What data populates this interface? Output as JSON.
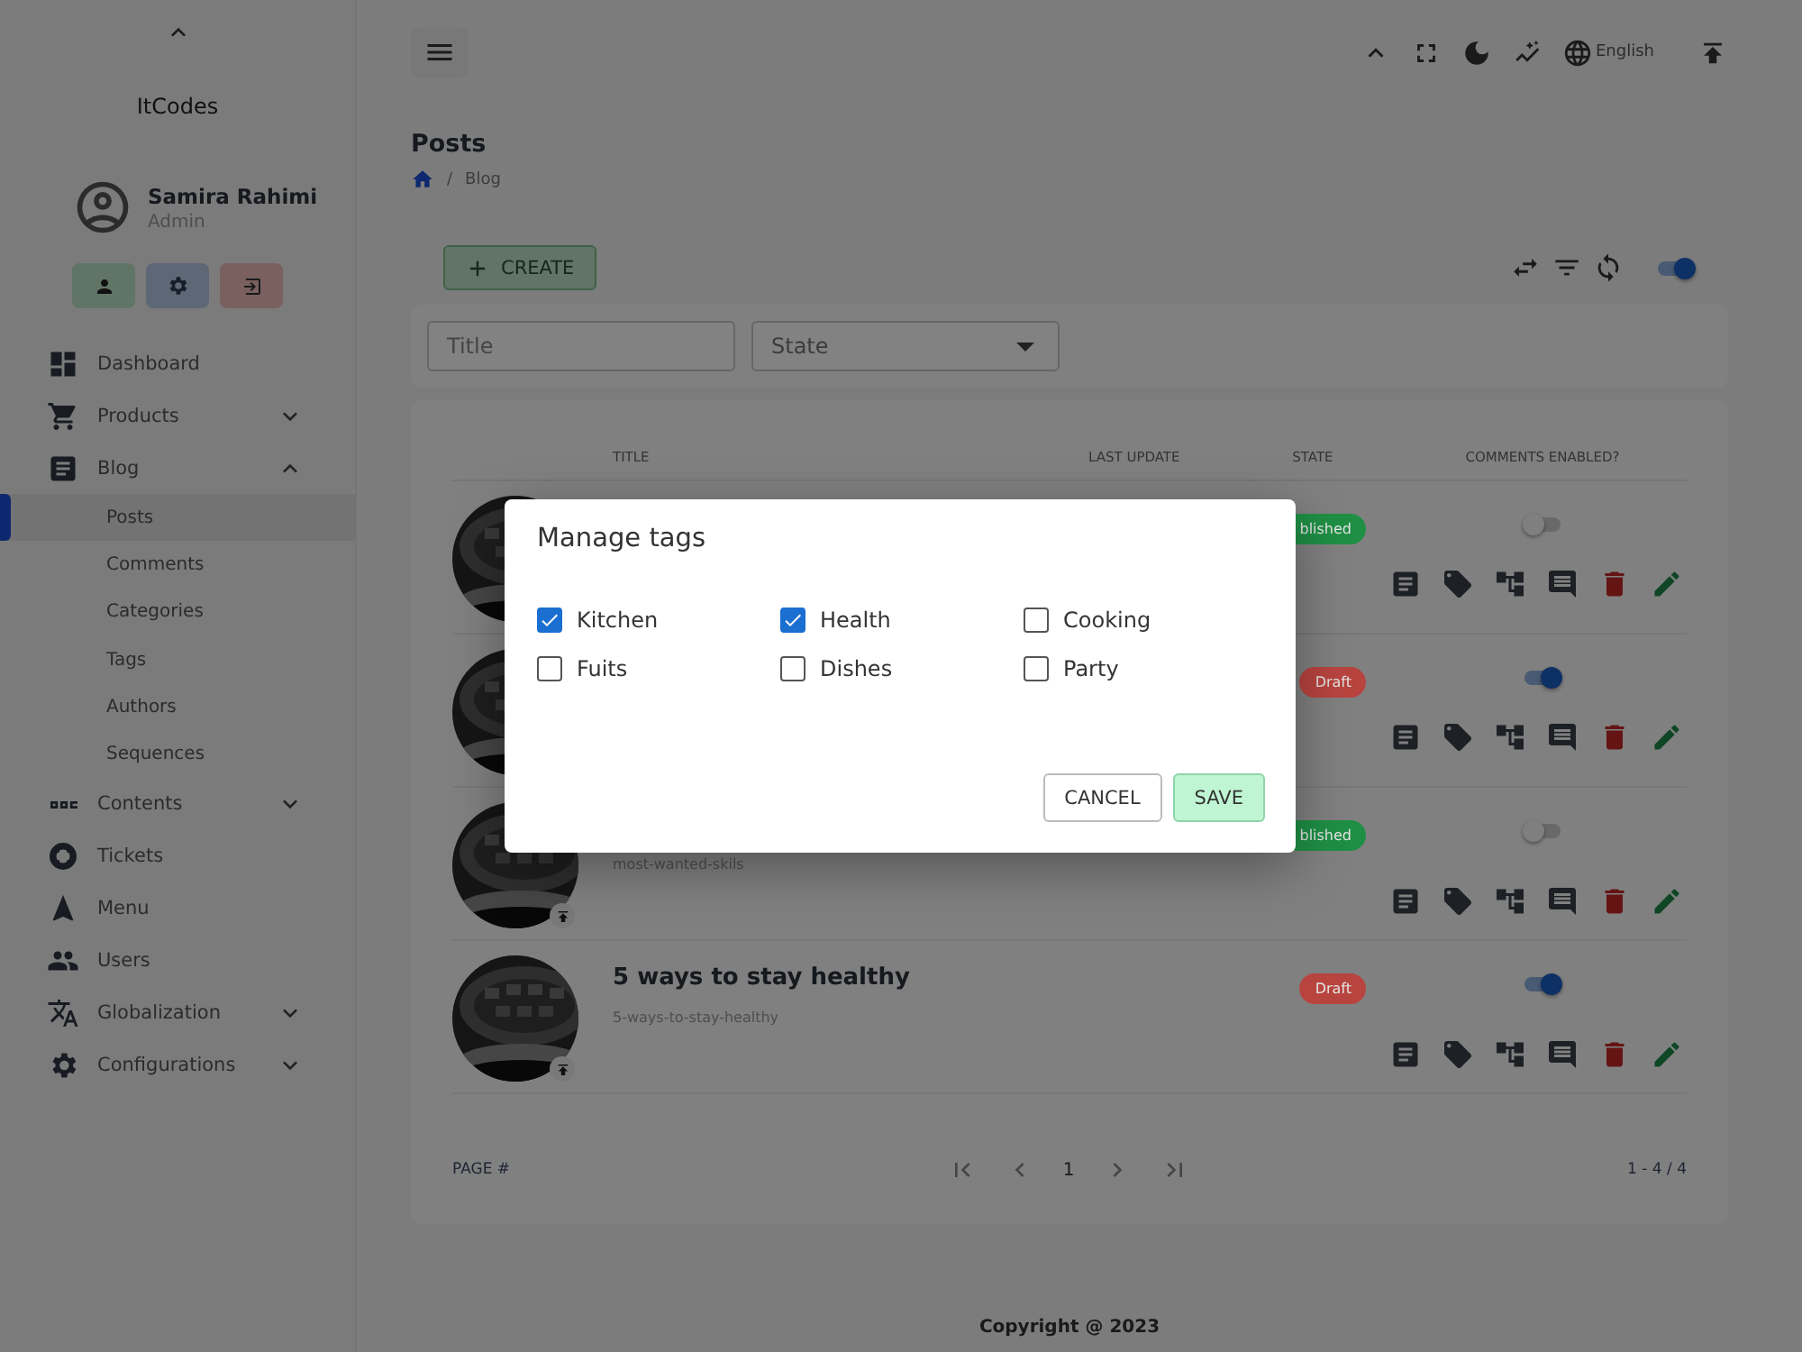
{
  "sidebar": {
    "brand": "ItCodes",
    "user": {
      "name": "Samira Rahimi",
      "role": "Admin"
    },
    "nav": [
      {
        "label": "Dashboard"
      },
      {
        "label": "Products",
        "expanded": false
      },
      {
        "label": "Blog",
        "expanded": true,
        "children": [
          {
            "label": "Posts",
            "selected": true
          },
          {
            "label": "Comments",
            "selected": false
          },
          {
            "label": "Categories",
            "selected": false
          },
          {
            "label": "Tags",
            "selected": false
          },
          {
            "label": "Authors",
            "selected": false
          },
          {
            "label": "Sequences",
            "selected": false
          }
        ]
      },
      {
        "label": "Contents",
        "expanded": false
      },
      {
        "label": "Tickets"
      },
      {
        "label": "Menu"
      },
      {
        "label": "Users"
      },
      {
        "label": "Globalization",
        "expanded": false
      },
      {
        "label": "Configurations",
        "expanded": false
      }
    ]
  },
  "topbar": {
    "language": "English"
  },
  "page": {
    "title": "Posts",
    "separator": "/",
    "breadcrumb": [
      "Blog"
    ]
  },
  "toolbar": {
    "create": "CREATE",
    "toggle_on": true
  },
  "filters": [
    {
      "kind": "text",
      "placeholder": "Title"
    },
    {
      "kind": "select",
      "placeholder": "State"
    }
  ],
  "table": {
    "columns": [
      "TITLE",
      "LAST UPDATE",
      "STATE",
      "COMMENTS ENABLED?"
    ],
    "rows": [
      {
        "state": "blished",
        "color": "#1f8f45",
        "comments_enabled": false
      },
      {
        "state": "Draft",
        "color": "#b8443f",
        "comments_enabled": true
      },
      {
        "slug": "most-wanted-skils",
        "state": "blished",
        "color": "#1f8f45",
        "comments_enabled": false
      },
      {
        "title": "5 ways to stay healthy",
        "slug": "5-ways-to-stay-healthy",
        "state": "Draft",
        "color": "#b8443f",
        "comments_enabled": true
      }
    ]
  },
  "pagination": {
    "label": "PAGE #",
    "current": "1",
    "range": "1 - 4 / 4"
  },
  "footer": "Copyright @ 2023",
  "modal": {
    "title": "Manage tags",
    "tags": [
      {
        "label": "Kitchen",
        "checked": true
      },
      {
        "label": "Health",
        "checked": true
      },
      {
        "label": "Cooking",
        "checked": false
      },
      {
        "label": "Fuits",
        "checked": false
      },
      {
        "label": "Dishes",
        "checked": false
      },
      {
        "label": "Party",
        "checked": false
      }
    ],
    "cancel": "CANCEL",
    "save": "SAVE"
  }
}
